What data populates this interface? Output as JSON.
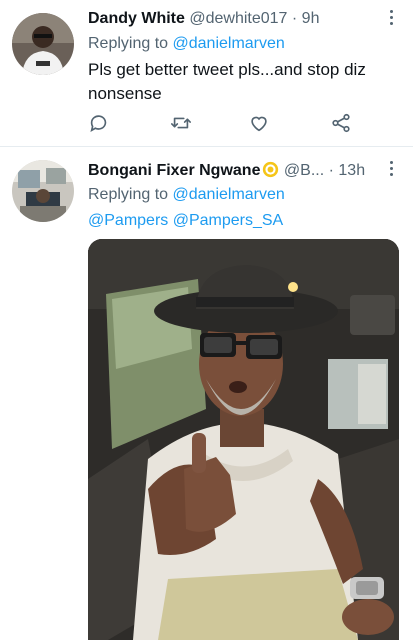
{
  "tweets": [
    {
      "name": "Dandy White",
      "handle": "@dewhite017",
      "dot": "·",
      "time": "9h",
      "replying_prefix": "Replying to",
      "replying_to": "@danielmarven",
      "text": "Pls get better tweet pls...and stop diz nonsense",
      "actions": [
        "reply-icon",
        "retweet-icon",
        "like-icon",
        "share-icon"
      ]
    },
    {
      "name": "Bongani Fixer Ngwane",
      "badge_icon": "gold-badge-icon",
      "handle": "@B...",
      "dot": "·",
      "time": "13h",
      "replying_prefix": "Replying to",
      "replying_to": "@danielmarven",
      "mentions": "@Pampers @Pampers_SA",
      "media": "video-thumbnail"
    }
  ],
  "colors": {
    "link": "#1d9bf0",
    "secondary_text": "#536471",
    "primary_text": "#0f1419",
    "divider": "#e6ecf0"
  }
}
